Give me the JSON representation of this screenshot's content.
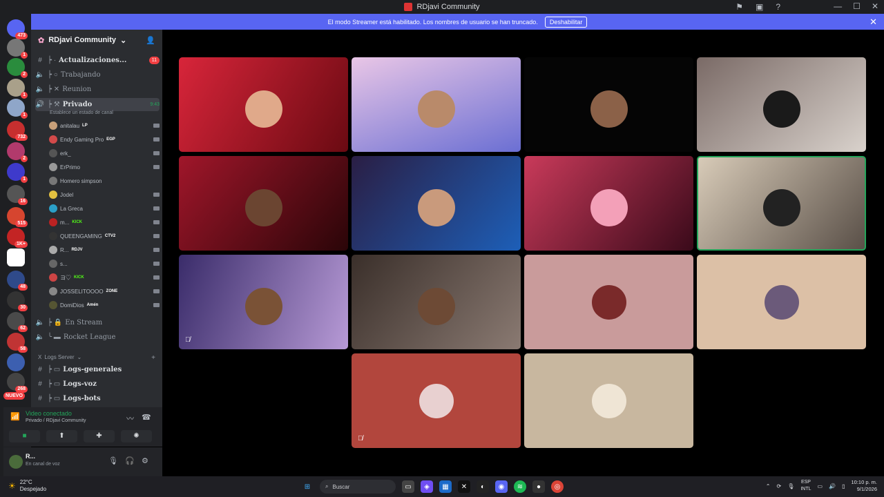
{
  "window": {
    "title": "RDjavi Community"
  },
  "banner": {
    "message": "El modo Streamer está habilitado. Los nombres de usuario se han truncado.",
    "button": "Deshabilitar"
  },
  "rail_badges": [
    "473",
    "1",
    "2",
    "1",
    "1",
    "732",
    "2",
    "1",
    "16",
    "515",
    "1K+",
    "48",
    "30",
    "62",
    "58",
    "268",
    "NUEVO"
  ],
  "guild": {
    "name": "RDjavi Community"
  },
  "channels": [
    {
      "name": "Actualizaciones...",
      "badge": "11"
    },
    {
      "name": "Trabajando"
    },
    {
      "name": "Reunion"
    },
    {
      "name": "Privado",
      "time": "9:43",
      "subtitle": "Establece un estado de canal"
    }
  ],
  "voice_users": [
    {
      "name": "anitalau",
      "tag": "LP"
    },
    {
      "name": "Endy Gaming Pro",
      "tag": "EGP"
    },
    {
      "name": "erk_",
      "tag": ""
    },
    {
      "name": "ErPrimo",
      "tag": ""
    },
    {
      "name": "Homero simpson",
      "tag": ""
    },
    {
      "name": "Jodel",
      "tag": ""
    },
    {
      "name": "La Greca",
      "tag": ""
    },
    {
      "name": "m...",
      "tag": "KICK"
    },
    {
      "name": "QUEENGAMING",
      "tag": "CTV2"
    },
    {
      "name": "R...",
      "tag": "RDJV"
    },
    {
      "name": "s...",
      "tag": ""
    },
    {
      "name": "ヨ♡",
      "tag": "KICK"
    },
    {
      "name": "JOSSELITOOOO",
      "tag": "ZONE"
    },
    {
      "name": "DomiDios",
      "tag": "Amén"
    }
  ],
  "channels2": [
    {
      "name": "En Stream"
    },
    {
      "name": "Rocket League"
    }
  ],
  "category": {
    "name": "Logs Server"
  },
  "log_channels": [
    {
      "name": "Logs-generales"
    },
    {
      "name": "Logs-voz"
    },
    {
      "name": "Logs-bots"
    }
  ],
  "voice_panel": {
    "status": "Video conectado",
    "location": "Privado / RDjavi Community"
  },
  "user_panel": {
    "name": "R...",
    "status": "En canal de voz"
  },
  "taskbar": {
    "weather_temp": "22°C",
    "weather_desc": "Despejado",
    "search_placeholder": "Buscar",
    "lang1": "ESP",
    "lang2": "INTL",
    "time": "10:10 p. m.",
    "date": "9/1/2026"
  }
}
